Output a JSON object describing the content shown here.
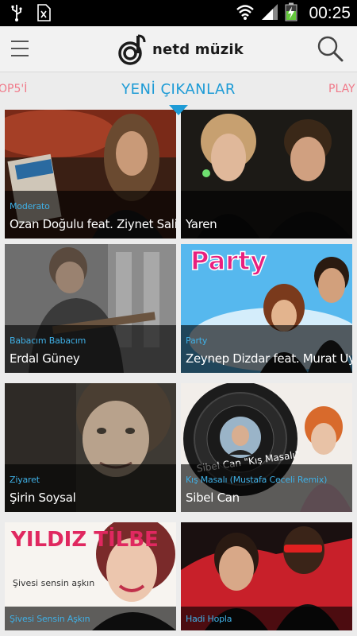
{
  "status_bar": {
    "time": "00:25",
    "icons": [
      "usb-icon",
      "sim-icon",
      "wifi-icon",
      "signal-icon",
      "battery-charging-icon"
    ]
  },
  "header": {
    "logo_text": "netd müzik",
    "menu_icon": "hamburger-icon",
    "search_icon": "search-icon"
  },
  "tabs": {
    "left": "OP5'İ",
    "active": "YENİ ÇIKANLAR",
    "right": "PLAY"
  },
  "colors": {
    "accent": "#1d9bd6",
    "inactive_tab": "#f07a8a",
    "album_text": "#3fb0e6"
  },
  "releases": [
    {
      "album": "Moderato",
      "artist": "Ozan Doğulu feat. Ziynet Sali"
    },
    {
      "album": "",
      "artist": "Yaren"
    },
    {
      "album": "Babacım Babacım",
      "artist": "Erdal Güney"
    },
    {
      "album": "Party",
      "artist": "Zeynep Dizdar feat. Murat Uyar"
    },
    {
      "album": "Ziyaret",
      "artist": "Şirin Soysal"
    },
    {
      "album": "Kış Masalı (Mustafa Ceceli Remix)",
      "artist": "Sibel Can"
    },
    {
      "album": "Şivesi Sensin Aşkın",
      "artist": ""
    },
    {
      "album": "Hadi Hopla",
      "artist": ""
    }
  ],
  "cover_texts": {
    "party_logo": "Party",
    "yildiz_logo": "YILDIZ TİLBE",
    "yildiz_sub": "Şivesi sensin aşkın",
    "sibel_vinyl": "Sibel Can \"Kış Masalı\""
  }
}
